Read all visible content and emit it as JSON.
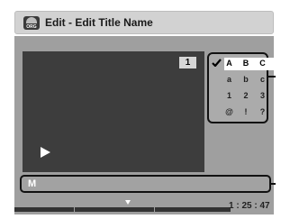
{
  "window": {
    "title": "Edit - Edit Title Name",
    "icon": "disc-org-icon",
    "icon_text": "ORG"
  },
  "preview": {
    "title_number": "1",
    "play_icon": "play-icon"
  },
  "char_palette": {
    "rows": [
      [
        "A",
        "B",
        "C"
      ],
      [
        "a",
        "b",
        "c"
      ],
      [
        "1",
        "2",
        "3"
      ],
      [
        "@",
        "!",
        "?"
      ]
    ],
    "selected_row": 0,
    "check_icon": "check-icon"
  },
  "name_field": {
    "value": "M"
  },
  "status": {
    "time": "1 : 25 : 47"
  },
  "colors": {
    "panel": "#9f9f9f",
    "preview": "#3d3d3d",
    "titlebar": "#d2d2d2",
    "highlight": "#ffffff"
  }
}
